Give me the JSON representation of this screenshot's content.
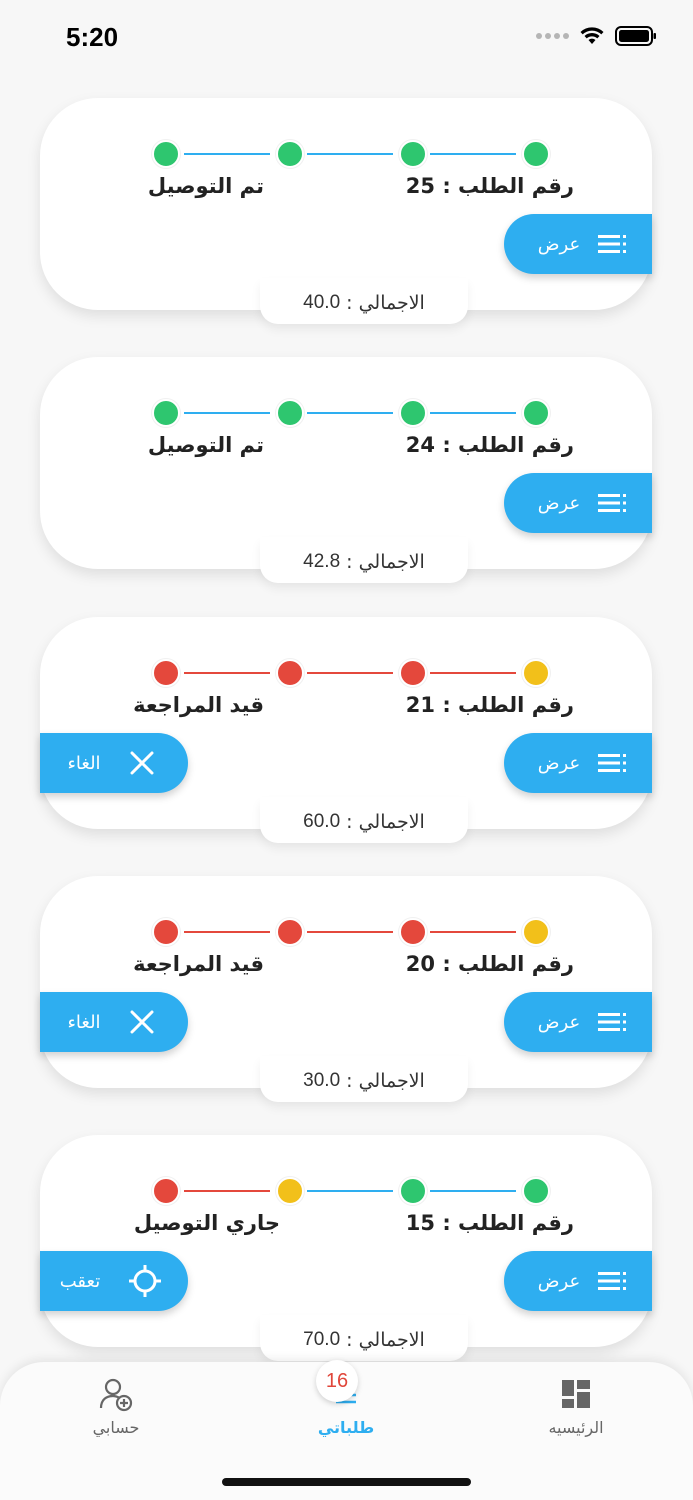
{
  "status_bar": {
    "time": "5:20"
  },
  "colors": {
    "green": "#2ec66f",
    "red": "#e4483c",
    "yellow": "#f2c01a",
    "blue_line": "#2eaef0",
    "red_line": "#e4483c",
    "accent": "#2eaef0"
  },
  "orders": [
    {
      "order_no": "رقم الطلب : 25",
      "status": "تم التوصيل",
      "view_label": "عرض",
      "total_label": "الاجمالي :",
      "total_value": "40.0",
      "steps": [
        "green",
        "green",
        "green",
        "green"
      ],
      "lines": [
        "blue",
        "blue",
        "blue"
      ],
      "left_button": null
    },
    {
      "order_no": "رقم الطلب : 24",
      "status": "تم التوصيل",
      "view_label": "عرض",
      "total_label": "الاجمالي :",
      "total_value": "42.8",
      "steps": [
        "green",
        "green",
        "green",
        "green"
      ],
      "lines": [
        "blue",
        "blue",
        "blue"
      ],
      "left_button": null
    },
    {
      "order_no": "رقم الطلب : 21",
      "status": "قيد المراجعة",
      "view_label": "عرض",
      "total_label": "الاجمالي :",
      "total_value": "60.0",
      "steps": [
        "yellow",
        "red",
        "red",
        "red"
      ],
      "lines": [
        "red",
        "red",
        "red"
      ],
      "left_button": {
        "type": "cancel",
        "label": "الغاء",
        "icon": "close-icon"
      }
    },
    {
      "order_no": "رقم الطلب : 20",
      "status": "قيد المراجعة",
      "view_label": "عرض",
      "total_label": "الاجمالي :",
      "total_value": "30.0",
      "steps": [
        "yellow",
        "red",
        "red",
        "red"
      ],
      "lines": [
        "red",
        "red",
        "red"
      ],
      "left_button": {
        "type": "cancel",
        "label": "الغاء",
        "icon": "close-icon"
      }
    },
    {
      "order_no": "رقم الطلب : 15",
      "status": "جاري التوصيل",
      "view_label": "عرض",
      "total_label": "الاجمالي :",
      "total_value": "70.0",
      "steps": [
        "green",
        "green",
        "yellow",
        "red"
      ],
      "lines": [
        "blue",
        "blue",
        "red"
      ],
      "left_button": {
        "type": "track",
        "label": "تعقب",
        "icon": "crosshair-icon"
      }
    }
  ],
  "bottom_nav": {
    "items": [
      {
        "label": "حسابي",
        "icon": "account-add-icon"
      },
      {
        "label": "طلباتي",
        "icon": "orders-list-icon",
        "badge": "16",
        "active": true
      },
      {
        "label": "الرئيسيه",
        "icon": "dashboard-icon"
      }
    ]
  }
}
